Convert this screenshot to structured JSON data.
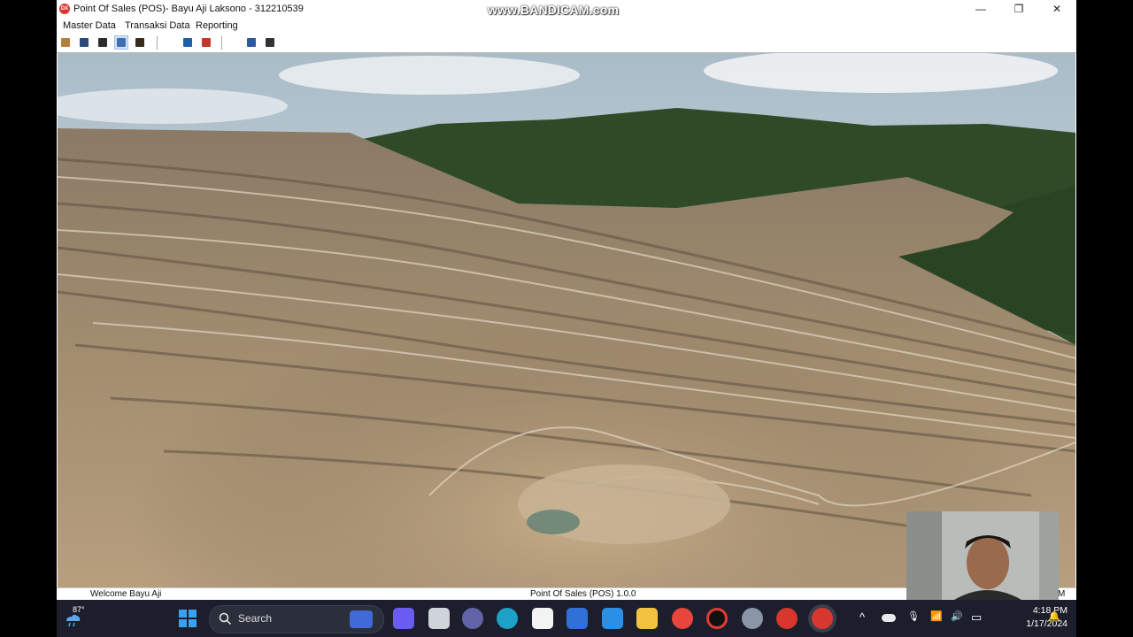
{
  "window": {
    "title": "Point Of Sales (POS)- Bayu Aji Laksono - 312210539",
    "app_icon_label": "DX",
    "watermark": "www.BANDICAM.com",
    "min_glyph": "—",
    "max_glyph": "❐",
    "close_glyph": "✕"
  },
  "menu": {
    "items": [
      {
        "label": "Master Data"
      },
      {
        "label": "Transaksi Data"
      },
      {
        "label": "Reporting"
      }
    ]
  },
  "toolbar": {
    "buttons": [
      {
        "icon": "user-icon",
        "color": "#b0813c"
      },
      {
        "icon": "supplier-icon",
        "color": "#2b4a7a"
      },
      {
        "icon": "product-icon",
        "color": "#2d2d2d"
      },
      {
        "icon": "category-icon",
        "color": "#3f6fb2",
        "active": true
      },
      {
        "icon": "customer-icon",
        "color": "#3a2a1a"
      },
      {
        "icon": "purchase-icon",
        "color": "#1f5fa6"
      },
      {
        "icon": "sales-icon",
        "color": "#c0392b"
      },
      {
        "icon": "report-icon",
        "color": "#2c5aa0"
      },
      {
        "icon": "print-icon",
        "color": "#333333"
      }
    ]
  },
  "statusbar": {
    "left": "Welcome Bayu Aji",
    "center": "Point Of Sales (POS) 1.0.0",
    "right": "M"
  },
  "taskbar": {
    "weather_temp": "87°",
    "search_placeholder": "Search",
    "clock_time": "4:18 PM",
    "clock_date": "1/17/2024",
    "apps": [
      {
        "icon": "windows-start-icon",
        "color": "#3aa0f0"
      },
      {
        "icon": "copilot-icon",
        "color": "#6a5cf0"
      },
      {
        "icon": "task-view-icon",
        "color": "#cfd3da"
      },
      {
        "icon": "teams-icon",
        "color": "#6264a7"
      },
      {
        "icon": "edge-icon",
        "color": "#1da1c9"
      },
      {
        "icon": "store-icon",
        "color": "#f3f3f3"
      },
      {
        "icon": "powerautomate-icon",
        "color": "#2f6fd6"
      },
      {
        "icon": "vscode-icon",
        "color": "#2b8fe6"
      },
      {
        "icon": "file-explorer-icon",
        "color": "#f3c340"
      },
      {
        "icon": "chrome-icon",
        "color": "#e8453c"
      },
      {
        "icon": "bandicam-record-icon",
        "color": "#e53935"
      },
      {
        "icon": "settings-icon",
        "color": "#8a96a8"
      },
      {
        "icon": "rx-icon",
        "color": "#d7372d"
      },
      {
        "icon": "delphi-dx-icon",
        "color": "#d7372d"
      }
    ]
  },
  "tray": {
    "chevron": "^",
    "mic": "🎙",
    "wifi": "📶",
    "volume": "🔊",
    "battery": "▭",
    "bell": "🔔"
  }
}
